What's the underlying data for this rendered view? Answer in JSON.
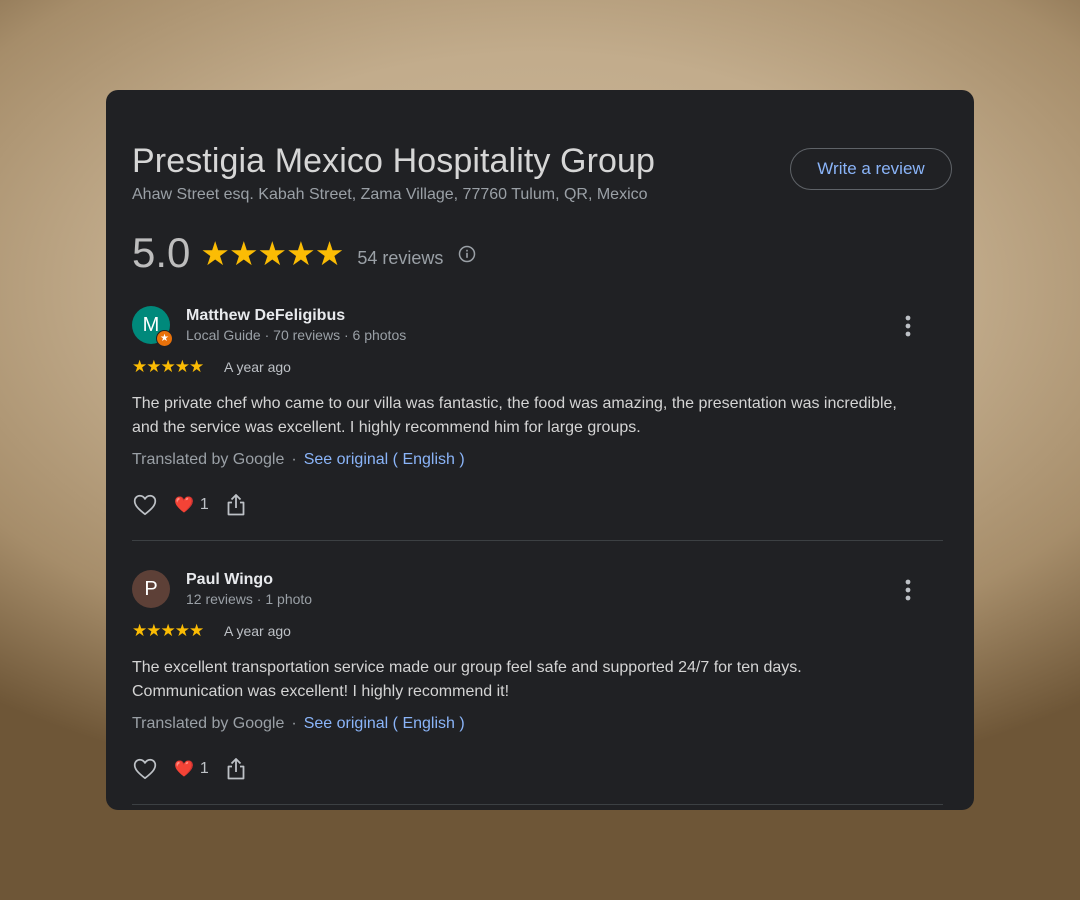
{
  "place": {
    "name": "Prestigia Mexico Hospitality Group",
    "address": "Ahaw Street esq. Kabah Street, Zama Village, 77760 Tulum, QR, Mexico",
    "write_review_label": "Write a review",
    "rating": "5.0",
    "stars": "★★★★★",
    "review_count": "54  reviews",
    "info_icon": "info-icon"
  },
  "colors": {
    "card_bg": "#202124",
    "accent_link": "#8ab4f8",
    "star": "#fbbc04",
    "guide_badge": "#e8710a"
  },
  "reviews": [
    {
      "avatar_letter": "M",
      "avatar_color": "#00897b",
      "local_guide": true,
      "name": "Matthew DeFeligibus",
      "meta": "Local Guide · 70 reviews · 6 photos",
      "stars": "★★★★★",
      "date": "A year ago",
      "text": "The private chef who came to our villa was fantastic, the food was amazing, the presentation was incredible, and the service was excellent. I highly recommend him for large groups.",
      "translated_by": "Translated by Google",
      "dot": "·",
      "see_original": "See original ( English )",
      "reaction_emoji": "❤️",
      "likes": "1"
    },
    {
      "avatar_letter": "P",
      "avatar_color": "#5d4037",
      "local_guide": false,
      "name": "Paul Wingo",
      "meta": "12 reviews · 1 photo",
      "stars": "★★★★★",
      "date": "A year ago",
      "text": "The excellent transportation service made our group feel safe and supported 24/7 for ten days. Communication was excellent! I highly recommend it!",
      "translated_by": "Translated by Google",
      "dot": "·",
      "see_original": "See original ( English )",
      "reaction_emoji": "❤️",
      "likes": "1"
    }
  ]
}
